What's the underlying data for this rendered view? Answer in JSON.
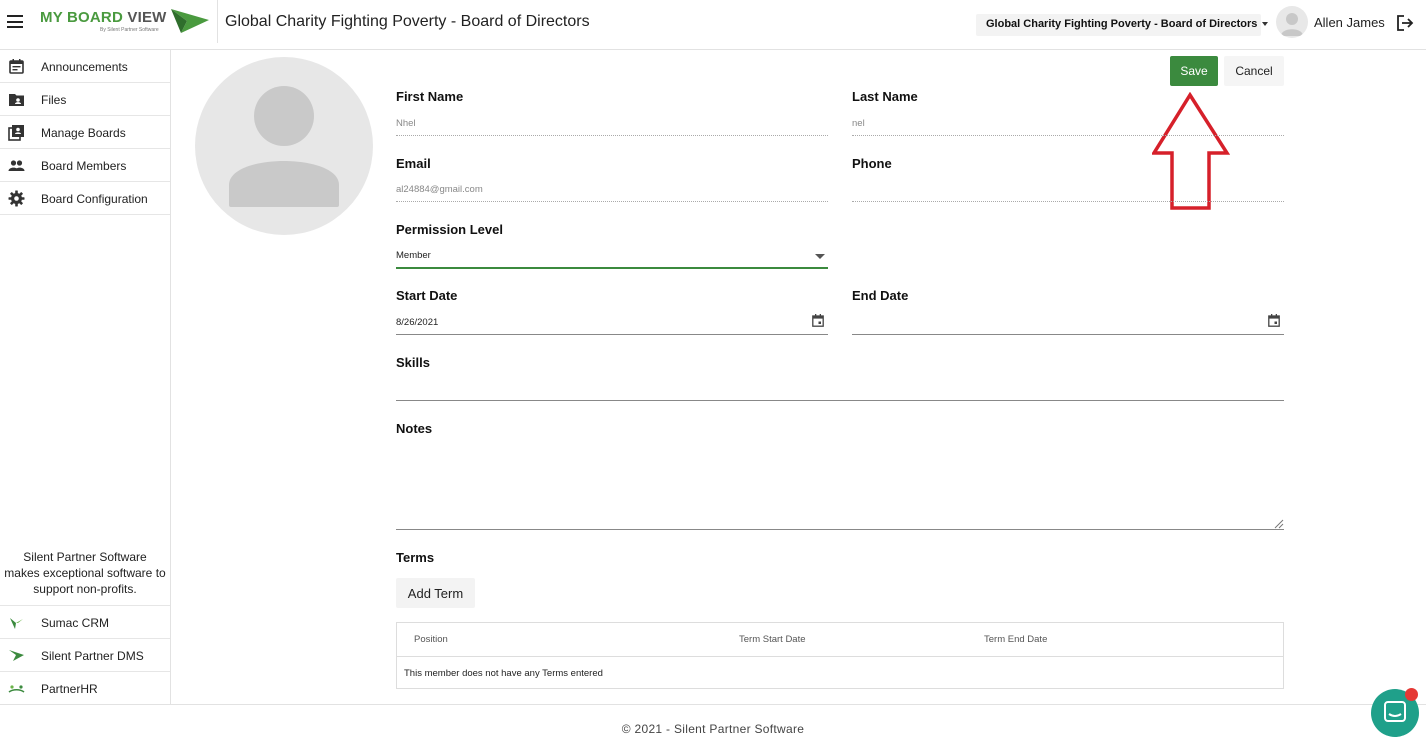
{
  "header": {
    "logo_text_main": "MY BOARD ",
    "logo_text_view": "VIEW",
    "logo_subtitle": "By Silent Partner Software",
    "title": "Global Charity Fighting Poverty - Board of Directors",
    "board_selector": "Global Charity Fighting Poverty - Board of Directors",
    "user_name": "Allen James"
  },
  "sidebar": {
    "items": [
      {
        "label": "Announcements",
        "icon": "calendar-icon"
      },
      {
        "label": "Files",
        "icon": "folder-icon"
      },
      {
        "label": "Manage Boards",
        "icon": "clipboard-icon"
      },
      {
        "label": "Board Members",
        "icon": "people-icon"
      },
      {
        "label": "Board Configuration",
        "icon": "gear-icon"
      }
    ],
    "tagline": "Silent Partner Software makes exceptional software to support non-profits.",
    "products": [
      {
        "label": "Sumac CRM",
        "icon": "sumac-logo-icon"
      },
      {
        "label": "Silent Partner DMS",
        "icon": "dms-logo-icon"
      },
      {
        "label": "PartnerHR",
        "icon": "partnerhr-logo-icon"
      }
    ]
  },
  "actions": {
    "save": "Save",
    "cancel": "Cancel"
  },
  "form": {
    "first_name_label": "First Name",
    "first_name_value": "Nhel",
    "last_name_label": "Last Name",
    "last_name_value": "nel",
    "email_label": "Email",
    "email_value": "al24884@gmail.com",
    "phone_label": "Phone",
    "phone_value": "",
    "permission_label": "Permission Level",
    "permission_value": "Member",
    "start_date_label": "Start Date",
    "start_date_value": "8/26/2021",
    "end_date_label": "End Date",
    "end_date_value": "",
    "skills_label": "Skills",
    "notes_label": "Notes"
  },
  "terms": {
    "title": "Terms",
    "add_button": "Add Term",
    "columns": [
      "Position",
      "Term Start Date",
      "Term End Date"
    ],
    "empty_message": "This member does not have any Terms entered"
  },
  "footer": {
    "text": "© 2021 - Silent Partner Software"
  },
  "colors": {
    "brand_green": "#3b8a3e",
    "annotation_red": "#d6202a",
    "chat_teal": "#1fa08a"
  }
}
